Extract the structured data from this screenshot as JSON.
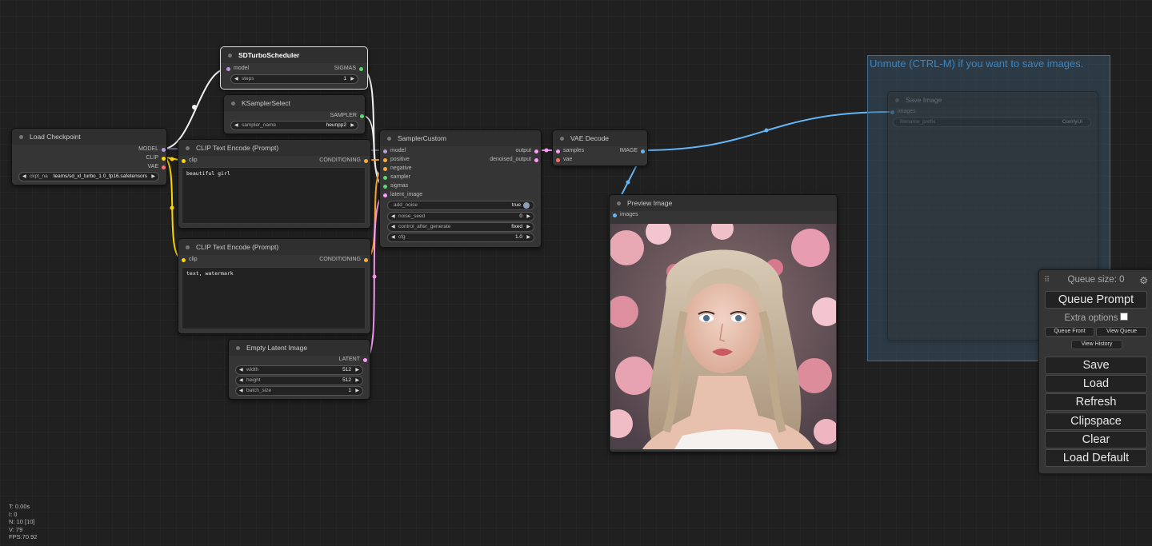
{
  "nodes": {
    "load_checkpoint": {
      "title": "Load Checkpoint",
      "outputs": [
        "MODEL",
        "CLIP",
        "VAE"
      ],
      "ckpt_label": "ckpt_na",
      "ckpt_value": "teams/sd_xl_turbo_1.0_fp16.safetensors"
    },
    "sd_turbo_scheduler": {
      "title": "SDTurboScheduler",
      "input": "model",
      "output": "SIGMAS",
      "steps_label": "steps",
      "steps_value": "1"
    },
    "ksampler_select": {
      "title": "KSamplerSelect",
      "output": "SAMPLER",
      "sampler_label": "sampler_name",
      "sampler_value": "heunpp2"
    },
    "clip_pos": {
      "title": "CLIP Text Encode (Prompt)",
      "input": "clip",
      "output": "CONDITIONING",
      "text": "beautiful girl"
    },
    "clip_neg": {
      "title": "CLIP Text Encode (Prompt)",
      "input": "clip",
      "output": "CONDITIONING",
      "text": "text, watermark"
    },
    "sampler_custom": {
      "title": "SamplerCustom",
      "inputs": [
        "model",
        "positive",
        "negative",
        "sampler",
        "sigmas",
        "latent_image"
      ],
      "outputs": [
        "output",
        "denoised_output"
      ],
      "widgets": [
        {
          "label": "add_noise",
          "value": "true"
        },
        {
          "label": "noise_seed",
          "value": "0"
        },
        {
          "label": "control_after_generate",
          "value": "fixed"
        },
        {
          "label": "cfg",
          "value": "1.0"
        }
      ]
    },
    "vae_decode": {
      "title": "VAE Decode",
      "inputs": [
        "samples",
        "vae"
      ],
      "output": "IMAGE"
    },
    "empty_latent": {
      "title": "Empty Latent Image",
      "output": "LATENT",
      "widgets": [
        {
          "label": "width",
          "value": "512"
        },
        {
          "label": "height",
          "value": "512"
        },
        {
          "label": "batch_size",
          "value": "1"
        }
      ]
    },
    "preview_image": {
      "title": "Preview Image",
      "input": "images"
    },
    "save_image": {
      "group_title": "Unmute (CTRL-M) if you want to save images.",
      "title": "Save Image",
      "input": "images",
      "prefix_label": "filename_prefix",
      "prefix_value": "ComfyUI"
    }
  },
  "menu": {
    "queue_size": "Queue size: 0",
    "queue_prompt": "Queue Prompt",
    "extra_options": "Extra options",
    "queue_front": "Queue Front",
    "view_queue": "View Queue",
    "view_history": "View History",
    "save": "Save",
    "load": "Load",
    "refresh": "Refresh",
    "clipspace": "Clipspace",
    "clear": "Clear",
    "load_default": "Load Default"
  },
  "stats": [
    "T: 0.00s",
    "I: 0",
    "N: 10 [10]",
    "V: 79",
    "FPS:70.92"
  ],
  "colors": {
    "model": "#b39ddb",
    "clip": "#ffd500",
    "vae": "#ff6e6e",
    "conditioning": "#ffa931",
    "latent": "#ff9cf9",
    "image": "#64b5f6",
    "sigmas": "#5bd86f",
    "sampler": "#5bd86f"
  }
}
